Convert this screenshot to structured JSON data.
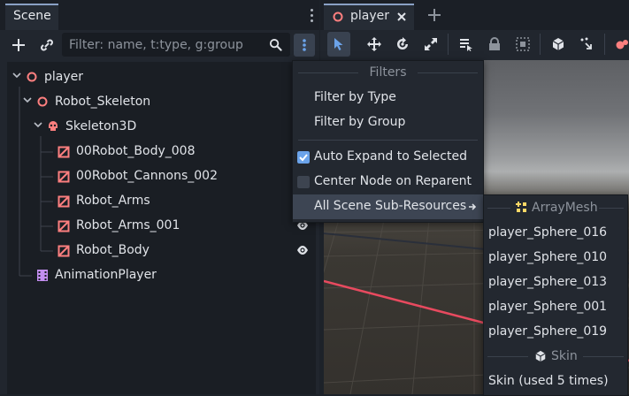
{
  "scene_dock": {
    "tab_label": "Scene",
    "filter_placeholder": "Filter: name, t:type, g:group"
  },
  "tree": [
    {
      "label": "player",
      "icon": "node3d-icon",
      "expand": "expanded"
    },
    {
      "label": "Robot_Skeleton",
      "icon": "node3d-icon",
      "expand": "expanded"
    },
    {
      "label": "Skeleton3D",
      "icon": "skeleton-icon",
      "expand": "expanded"
    },
    {
      "label": "00Robot_Body_008",
      "icon": "mesh-instance-icon"
    },
    {
      "label": "00Robot_Cannons_002",
      "icon": "mesh-instance-icon"
    },
    {
      "label": "Robot_Arms",
      "icon": "mesh-instance-icon"
    },
    {
      "label": "Robot_Arms_001",
      "icon": "mesh-instance-icon",
      "visible_toggle": true
    },
    {
      "label": "Robot_Body",
      "icon": "mesh-instance-icon",
      "visible_toggle": true
    },
    {
      "label": "AnimationPlayer",
      "icon": "animation-player-icon"
    }
  ],
  "editor_tab": {
    "label": "player"
  },
  "filter_menu": {
    "header": "Filters",
    "items": [
      {
        "label": "Filter by Type"
      },
      {
        "label": "Filter by Group"
      },
      {
        "label": "Auto Expand to Selected",
        "checked": true
      },
      {
        "label": "Center Node on Reparent",
        "checked": false
      },
      {
        "label": "All Scene Sub-Resources",
        "submenu": true
      }
    ]
  },
  "sub_menu": {
    "mesh_header": "ArrayMesh",
    "meshes": [
      "player_Sphere_016",
      "player_Sphere_010",
      "player_Sphere_013",
      "player_Sphere_001",
      "player_Sphere_019"
    ],
    "skin_header": "Skin",
    "skins": [
      "Skin (used 5 times)"
    ]
  },
  "colors": {
    "accent": "#8aa1c5",
    "node3d": "#fc7f7f",
    "animation": "#c38ef1",
    "checkbox": "#6ba3ea",
    "highlight": "#3d4553"
  }
}
